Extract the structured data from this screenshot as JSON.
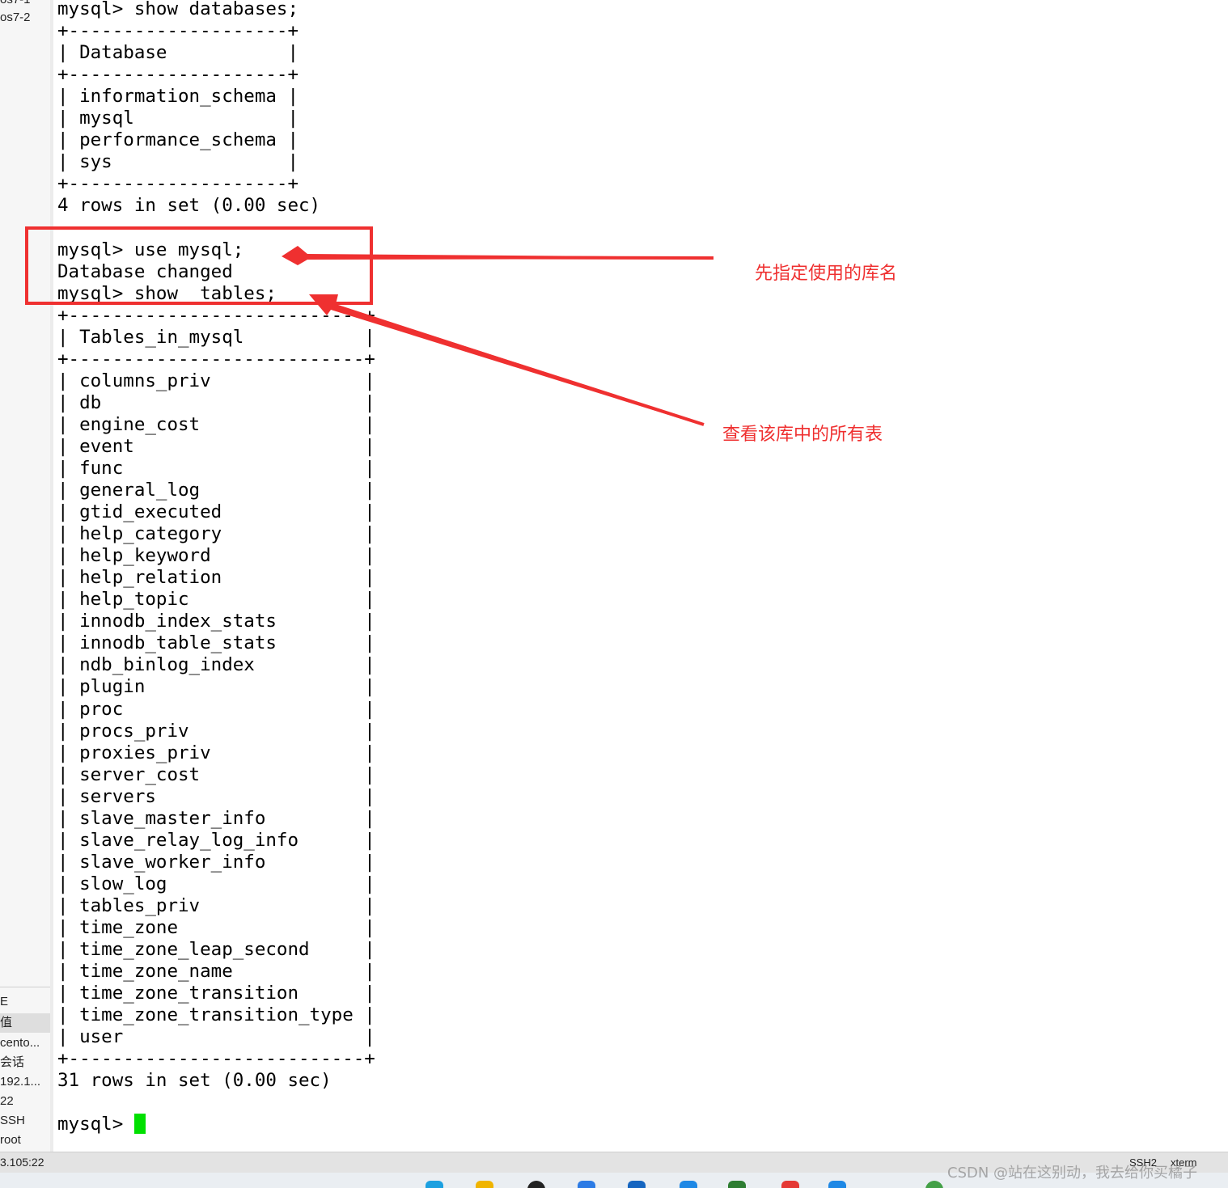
{
  "sidebar": {
    "sessions": [
      "os7-1",
      "os7-2"
    ],
    "properties_title": "E",
    "properties_header": "值",
    "properties": [
      "cento...",
      "会话",
      "192.1...",
      "22",
      "SSH",
      "root"
    ]
  },
  "terminal": {
    "lines": [
      "mysql> show databases;",
      "+--------------------+",
      "| Database           |",
      "+--------------------+",
      "| information_schema |",
      "| mysql              |",
      "| performance_schema |",
      "| sys                |",
      "+--------------------+",
      "4 rows in set (0.00 sec)",
      "",
      "mysql> use mysql;",
      "Database changed",
      "mysql> show  tables;",
      "+---------------------------+",
      "| Tables_in_mysql           |",
      "+---------------------------+",
      "| columns_priv              |",
      "| db                        |",
      "| engine_cost               |",
      "| event                     |",
      "| func                      |",
      "| general_log               |",
      "| gtid_executed             |",
      "| help_category             |",
      "| help_keyword              |",
      "| help_relation             |",
      "| help_topic                |",
      "| innodb_index_stats        |",
      "| innodb_table_stats        |",
      "| ndb_binlog_index          |",
      "| plugin                    |",
      "| proc                      |",
      "| procs_priv                |",
      "| proxies_priv              |",
      "| server_cost               |",
      "| servers                   |",
      "| slave_master_info         |",
      "| slave_relay_log_info      |",
      "| slave_worker_info         |",
      "| slow_log                  |",
      "| tables_priv               |",
      "| time_zone                 |",
      "| time_zone_leap_second     |",
      "| time_zone_name            |",
      "| time_zone_transition      |",
      "| time_zone_transition_type |",
      "| user                      |",
      "+---------------------------+",
      "31 rows in set (0.00 sec)",
      ""
    ],
    "prompt": "mysql> "
  },
  "annotations": {
    "use_db": "先指定使用的库名",
    "show_tables": "查看该库中的所有表",
    "color": "#ef3030"
  },
  "statusbar": {
    "ip": "3.105:22",
    "protocol": "SSH2",
    "terminal_type": "xterm"
  },
  "watermark": "CSDN @站在这别动，我去给你买橘子",
  "colors": {
    "cursor": "#00e000",
    "annotation": "#ef3030"
  }
}
